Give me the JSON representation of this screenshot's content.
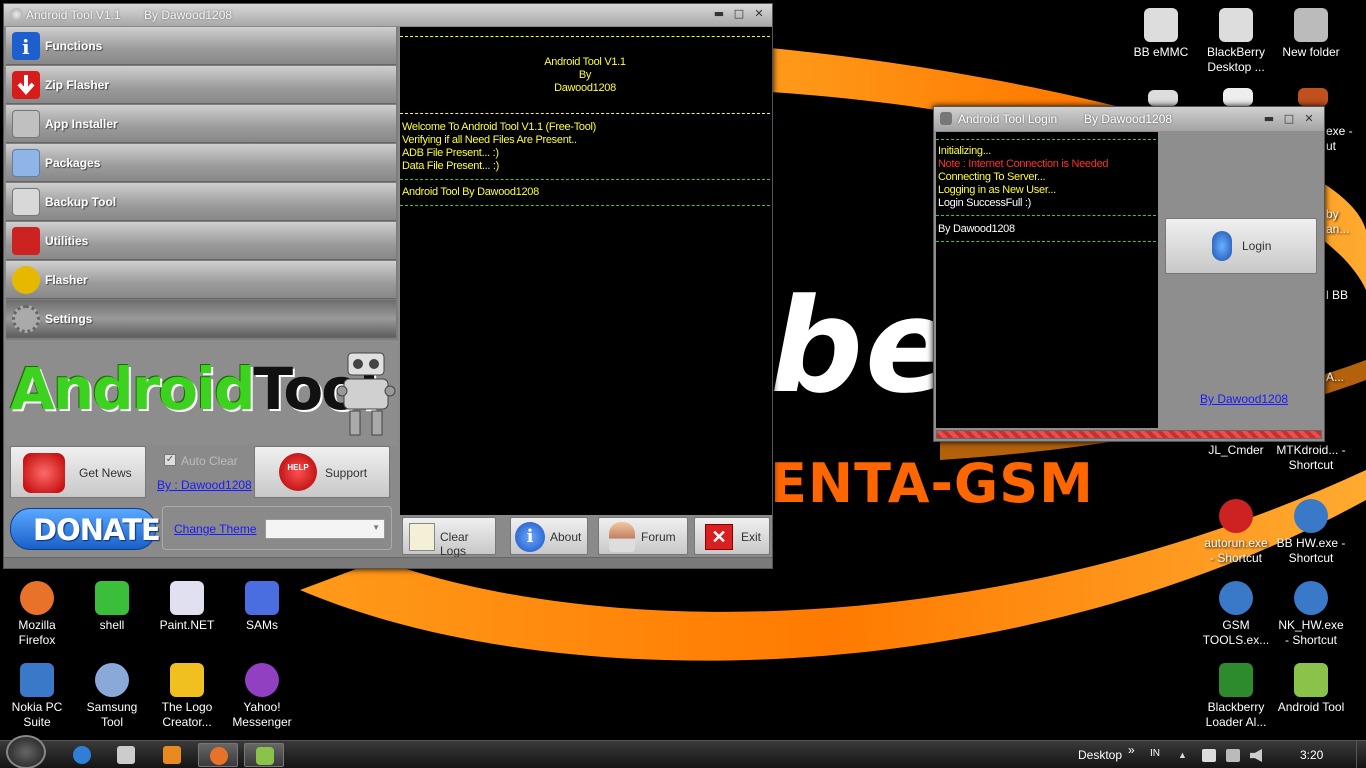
{
  "main_window": {
    "title": "Android Tool V1.1",
    "title_by": "By Dawood1208",
    "controls": {
      "minimize": "▬",
      "maximize": "□",
      "close": "✕"
    }
  },
  "sidebar": {
    "items": [
      {
        "label": "Functions",
        "icon": "info-icon",
        "color": "#1e5fd0"
      },
      {
        "label": "Zip Flasher",
        "icon": "download-arrow-icon",
        "color": "#d81b1b"
      },
      {
        "label": "App Installer",
        "icon": "drive-icon",
        "color": "#c0c0c0"
      },
      {
        "label": "Packages",
        "icon": "package-icon",
        "color": "#8fb4e6"
      },
      {
        "label": "Backup Tool",
        "icon": "backup-drive-icon",
        "color": "#d8d8d8"
      },
      {
        "label": "Utilities",
        "icon": "toolbox-icon",
        "color": "#cc2222"
      },
      {
        "label": "Flasher",
        "icon": "undo-arrow-icon",
        "color": "#e6b800"
      },
      {
        "label": "Settings",
        "icon": "gear-icon",
        "color": "#aaaaaa"
      }
    ]
  },
  "logo": {
    "part1": "Android",
    "part2": "Tool"
  },
  "buttons": {
    "get_news": "Get News",
    "support": "Support",
    "support_badge": "HELP",
    "donate": "DONATE",
    "clear_logs": "Clear Logs",
    "about": "About",
    "forum": "Forum",
    "exit": "Exit"
  },
  "options": {
    "auto_clear": "Auto Clear",
    "by_link": "By : Dawood1208",
    "change_theme": "Change Theme",
    "theme_value": ""
  },
  "console": {
    "header": [
      "Android Tool V1.1",
      "By",
      "Dawood1208"
    ],
    "log": [
      "Welcome To Android Tool V1.1 (Free-Tool)",
      "Verifying if all Need Files Are Present..",
      "ADB File Present... :)",
      "Data File Present... :)"
    ],
    "footer": "Android Tool By Dawood1208"
  },
  "login_window": {
    "title": "Android Tool  Login",
    "title_by": "By Dawood1208",
    "controls": {
      "minimize": "▬",
      "maximize": "□",
      "close": "✕"
    },
    "log": [
      {
        "text": "Initializing...",
        "style": "yellow"
      },
      {
        "text": "Note : Internet Connection is Needed",
        "style": "red"
      },
      {
        "text": "Connecting To Server...",
        "style": "yellow"
      },
      {
        "text": "Logging in as New User...",
        "style": "yellow"
      },
      {
        "text": "Login SuccessFull :)",
        "style": "white"
      }
    ],
    "footer": "By Dawood1208",
    "login_button": "Login",
    "by_link": "By Dawood1208"
  },
  "wallpaper": {
    "big_text": "be",
    "brand_text": "ENTA-GSM"
  },
  "desktop_icons_right": [
    {
      "label": "BB eMMC",
      "color": "#dddddd"
    },
    {
      "label": "BlackBerry Desktop ...",
      "color": "#dddddd"
    },
    {
      "label": "New folder",
      "color": "#bbbbbb"
    }
  ],
  "desktop_partial_labels": [
    "exe -",
    "ut",
    "by",
    "an...",
    "l BB",
    "A..."
  ],
  "desktop_icons_right_lower": [
    {
      "label": "JL_Cmder",
      "color": "#555555"
    },
    {
      "label": "MTKdroid... - Shortcut",
      "color": "#5aa02c"
    },
    {
      "label": "autorun.exe - Shortcut",
      "color": "#cc2222"
    },
    {
      "label": "BB HW.exe - Shortcut",
      "color": "#3a78c8"
    },
    {
      "label": "GSM TOOLS.ex...",
      "color": "#3a78c8"
    },
    {
      "label": "NK_HW.exe - Shortcut",
      "color": "#3a78c8"
    },
    {
      "label": "Blackberry Loader Al...",
      "color": "#2d8a2d"
    },
    {
      "label": "Android Tool",
      "color": "#8bc34a"
    }
  ],
  "desktop_icons_bottom": [
    {
      "label": "Mozilla Firefox",
      "color": "#e8722a"
    },
    {
      "label": "shell",
      "color": "#3bbf3b"
    },
    {
      "label": "Paint.NET",
      "color": "#e0e0f0"
    },
    {
      "label": "SAMs",
      "color": "#4a6ee0"
    },
    {
      "label": "Nokia PC Suite",
      "color": "#3a78c8"
    },
    {
      "label": "Samsung Tool",
      "color": "#8aa8d8"
    },
    {
      "label": "The Logo Creator...",
      "color": "#f0c020"
    },
    {
      "label": "Yahoo! Messenger",
      "color": "#9040c0"
    }
  ],
  "taskbar": {
    "items": [
      {
        "icon": "internet-explorer-icon",
        "color": "#2f7fd6"
      },
      {
        "icon": "windows-explorer-icon",
        "color": "#cccccc"
      },
      {
        "icon": "media-player-icon",
        "color": "#e88a20"
      },
      {
        "icon": "firefox-icon",
        "color": "#e8722a"
      },
      {
        "icon": "android-icon",
        "color": "#8bc34a"
      }
    ],
    "desktop_label": "Desktop",
    "chevron": "»",
    "lang": "IN",
    "clock": "3:20"
  }
}
